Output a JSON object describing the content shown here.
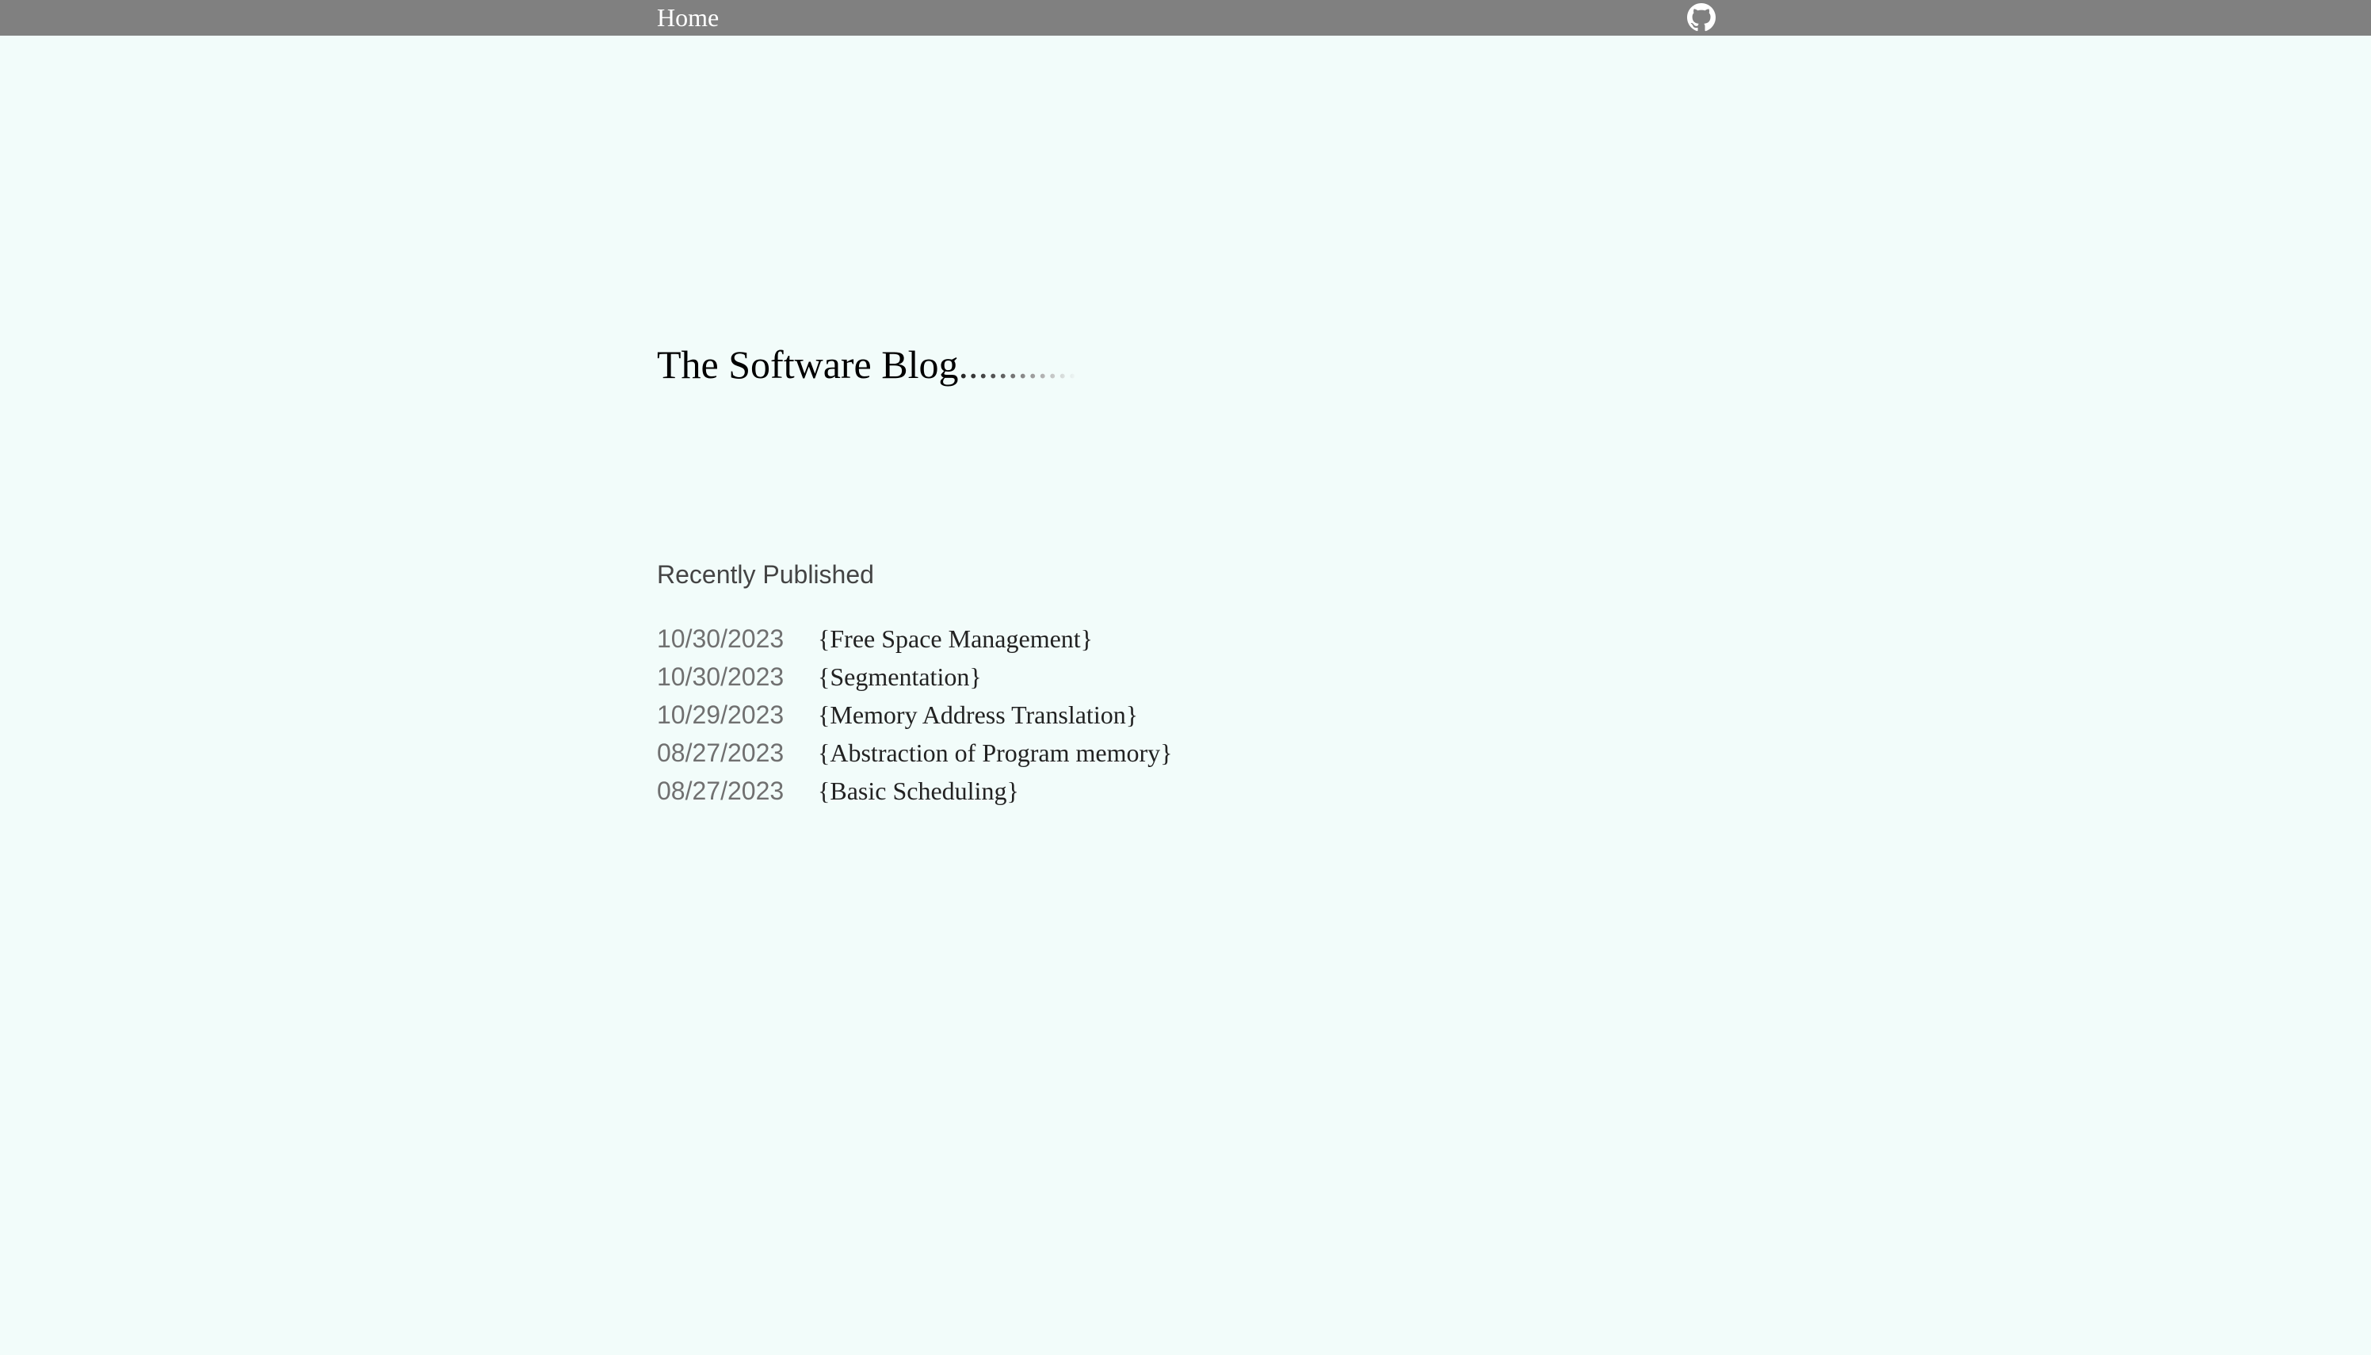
{
  "nav": {
    "home_label": "Home",
    "github_icon": "github-icon"
  },
  "hero": {
    "title": "The Software Blog",
    "title_dots": "............"
  },
  "recent": {
    "heading": "Recently Published",
    "posts": [
      {
        "date": "10/30/2023",
        "title": "{Free Space Management}"
      },
      {
        "date": "10/30/2023",
        "title": "{Segmentation}"
      },
      {
        "date": "10/29/2023",
        "title": "{Memory Address Translation}"
      },
      {
        "date": "08/27/2023",
        "title": "{Abstraction of Program memory}"
      },
      {
        "date": "08/27/2023",
        "title": "{Basic Scheduling}"
      }
    ]
  },
  "colors": {
    "background": "#f2fcfa",
    "topbar": "#808080",
    "nav_text": "#ffffff",
    "date_text": "#707070",
    "heading_text": "#444444"
  }
}
